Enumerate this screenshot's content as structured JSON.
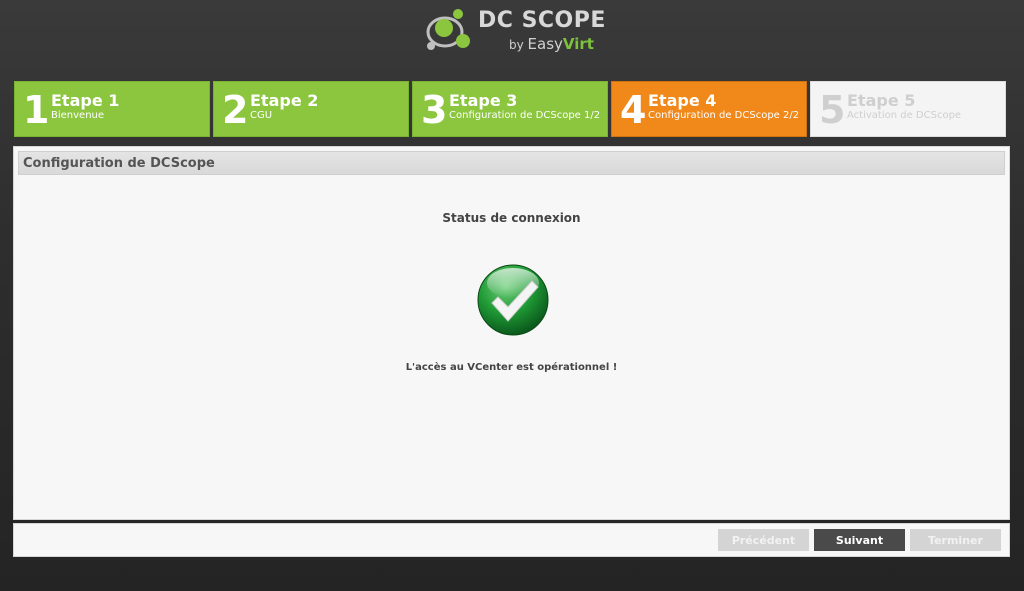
{
  "logo": {
    "title": "DC SCOPE",
    "by": "by ",
    "easy": "Easy",
    "virt": "Virt",
    "icon": "dcscope-logo-icon"
  },
  "steps": [
    {
      "number": "1",
      "title": "Etape 1",
      "subtitle": "Bienvenue",
      "state": "done"
    },
    {
      "number": "2",
      "title": "Etape 2",
      "subtitle": "CGU",
      "state": "done"
    },
    {
      "number": "3",
      "title": "Etape 3",
      "subtitle": "Configuration de DCScope 1/2",
      "state": "done"
    },
    {
      "number": "4",
      "title": "Etape 4",
      "subtitle": "Configuration de DCScope 2/2",
      "state": "active"
    },
    {
      "number": "5",
      "title": "Etape 5",
      "subtitle": "Activation de DCScope",
      "state": "todo"
    }
  ],
  "panel": {
    "title": "Configuration de DCScope",
    "status_title": "Status de connexion",
    "status_icon": "check-success-icon",
    "status_message": "L'accès au VCenter est opérationnel !"
  },
  "footer": {
    "previous_label": "Précédent",
    "next_label": "Suivant",
    "finish_label": "Terminer"
  },
  "colors": {
    "done": "#8cc63f",
    "active": "#f0881a",
    "todo": "#f4f4f4",
    "brand_green": "#7cc23c"
  }
}
